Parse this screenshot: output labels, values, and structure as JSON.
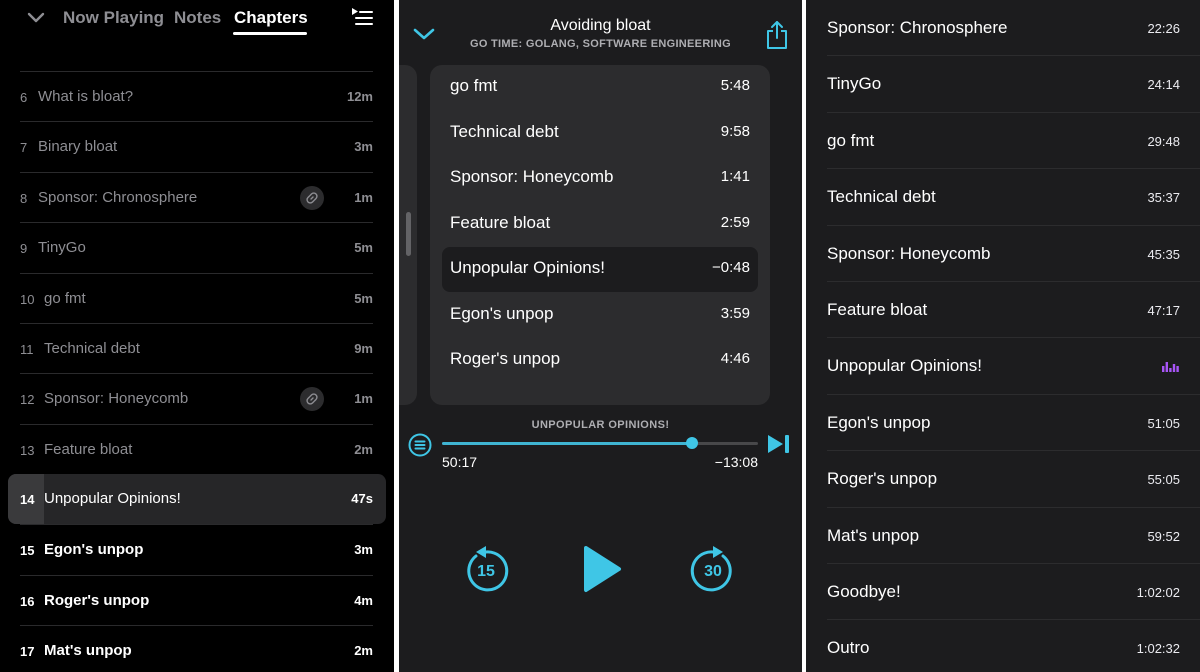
{
  "panel1": {
    "tabs": [
      {
        "label": "Now Playing",
        "active": false
      },
      {
        "label": "Notes",
        "active": false
      },
      {
        "label": "Chapters",
        "active": true
      }
    ],
    "chapters": [
      {
        "num": "6",
        "title": "What is bloat?",
        "duration": "12m",
        "state": "past",
        "link": false
      },
      {
        "num": "7",
        "title": "Binary bloat",
        "duration": "3m",
        "state": "past",
        "link": false
      },
      {
        "num": "8",
        "title": "Sponsor: Chronosphere",
        "duration": "1m",
        "state": "past",
        "link": true
      },
      {
        "num": "9",
        "title": "TinyGo",
        "duration": "5m",
        "state": "past",
        "link": false
      },
      {
        "num": "10",
        "title": "go fmt",
        "duration": "5m",
        "state": "past",
        "link": false
      },
      {
        "num": "11",
        "title": "Technical debt",
        "duration": "9m",
        "state": "past",
        "link": false
      },
      {
        "num": "12",
        "title": "Sponsor: Honeycomb",
        "duration": "1m",
        "state": "past",
        "link": true
      },
      {
        "num": "13",
        "title": "Feature bloat",
        "duration": "2m",
        "state": "past",
        "link": false
      },
      {
        "num": "14",
        "title": "Unpopular Opinions!",
        "duration": "47s",
        "state": "current",
        "link": false
      },
      {
        "num": "15",
        "title": "Egon's unpop",
        "duration": "3m",
        "state": "future",
        "link": false
      },
      {
        "num": "16",
        "title": "Roger's unpop",
        "duration": "4m",
        "state": "future",
        "link": false
      },
      {
        "num": "17",
        "title": "Mat's unpop",
        "duration": "2m",
        "state": "future",
        "link": false
      }
    ]
  },
  "panel2": {
    "title": "Avoiding bloat",
    "subtitle": "GO TIME: GOLANG, SOFTWARE ENGINEERING",
    "chapters": [
      {
        "title": "go fmt",
        "time": "5:48",
        "current": false
      },
      {
        "title": "Technical debt",
        "time": "9:58",
        "current": false
      },
      {
        "title": "Sponsor: Honeycomb",
        "time": "1:41",
        "current": false
      },
      {
        "title": "Feature bloat",
        "time": "2:59",
        "current": false
      },
      {
        "title": "Unpopular Opinions!",
        "time": "−0:48",
        "current": true
      },
      {
        "title": "Egon's unpop",
        "time": "3:59",
        "current": false
      },
      {
        "title": "Roger's unpop",
        "time": "4:46",
        "current": false
      }
    ],
    "current_chapter": "UNPOPULAR OPINIONS!",
    "elapsed": "50:17",
    "remaining": "−13:08",
    "progress_fraction": 0.79,
    "skip_back": "15",
    "skip_forward": "30",
    "accent_color": "#3fc6e6"
  },
  "panel3": {
    "chapters": [
      {
        "title": "Sponsor: Chronosphere",
        "time": "22:26",
        "playing": false
      },
      {
        "title": "TinyGo",
        "time": "24:14",
        "playing": false
      },
      {
        "title": "go fmt",
        "time": "29:48",
        "playing": false
      },
      {
        "title": "Technical debt",
        "time": "35:37",
        "playing": false
      },
      {
        "title": "Sponsor: Honeycomb",
        "time": "45:35",
        "playing": false
      },
      {
        "title": "Feature bloat",
        "time": "47:17",
        "playing": false
      },
      {
        "title": "Unpopular Opinions!",
        "time": "",
        "playing": true
      },
      {
        "title": "Egon's unpop",
        "time": "51:05",
        "playing": false
      },
      {
        "title": "Roger's unpop",
        "time": "55:05",
        "playing": false
      },
      {
        "title": "Mat's unpop",
        "time": "59:52",
        "playing": false
      },
      {
        "title": "Goodbye!",
        "time": "1:02:02",
        "playing": false
      },
      {
        "title": "Outro",
        "time": "1:02:32",
        "playing": false
      }
    ],
    "playing_indicator_color": "#a855f7"
  }
}
